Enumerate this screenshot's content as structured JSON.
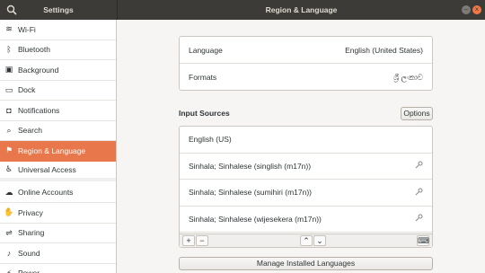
{
  "window": {
    "sidebar_title": "Settings",
    "main_title": "Region & Language",
    "minimize_glyph": "–",
    "close_glyph": "×"
  },
  "sidebar": {
    "items": [
      {
        "label": "Wi-Fi",
        "icon": "wifi-icon",
        "glyph": "≋"
      },
      {
        "label": "Bluetooth",
        "icon": "bluetooth-icon",
        "glyph": "ᛒ"
      },
      {
        "label": "Background",
        "icon": "background-icon",
        "glyph": "▣"
      },
      {
        "label": "Dock",
        "icon": "dock-icon",
        "glyph": "▭"
      },
      {
        "label": "Notifications",
        "icon": "notifications-icon",
        "glyph": "◘"
      },
      {
        "label": "Search",
        "icon": "search-icon",
        "glyph": "⌕"
      },
      {
        "label": "Region & Language",
        "icon": "region-icon",
        "glyph": "⚑",
        "active": true
      },
      {
        "label": "Universal Access",
        "icon": "universal-access-icon",
        "glyph": "♿"
      },
      {
        "label": "Online Accounts",
        "icon": "online-accounts-icon",
        "glyph": "☁"
      },
      {
        "label": "Privacy",
        "icon": "privacy-icon",
        "glyph": "✋"
      },
      {
        "label": "Sharing",
        "icon": "sharing-icon",
        "glyph": "⇌"
      },
      {
        "label": "Sound",
        "icon": "sound-icon",
        "glyph": "♪"
      },
      {
        "label": "Power",
        "icon": "power-icon",
        "glyph": "⚡"
      }
    ]
  },
  "region": {
    "language_label": "Language",
    "language_value": "English (United States)",
    "formats_label": "Formats",
    "formats_value": "ශ්‍රී ලංකාව"
  },
  "input_sources": {
    "title": "Input Sources",
    "options_label": "Options",
    "sources": [
      {
        "name": "English (US)",
        "has_key": false
      },
      {
        "name": "Sinhala; Sinhalese (singlish (m17n))",
        "has_key": true
      },
      {
        "name": "Sinhala; Sinhalese (sumihiri (m17n))",
        "has_key": true
      },
      {
        "name": "Sinhala; Sinhalese (wijesekera (m17n))",
        "has_key": true
      }
    ],
    "toolbar": {
      "add": "+",
      "remove": "−",
      "up": "⌃",
      "down": "⌄",
      "keyboard": "⌨"
    }
  },
  "manage_button_label": "Manage Installed Languages"
}
